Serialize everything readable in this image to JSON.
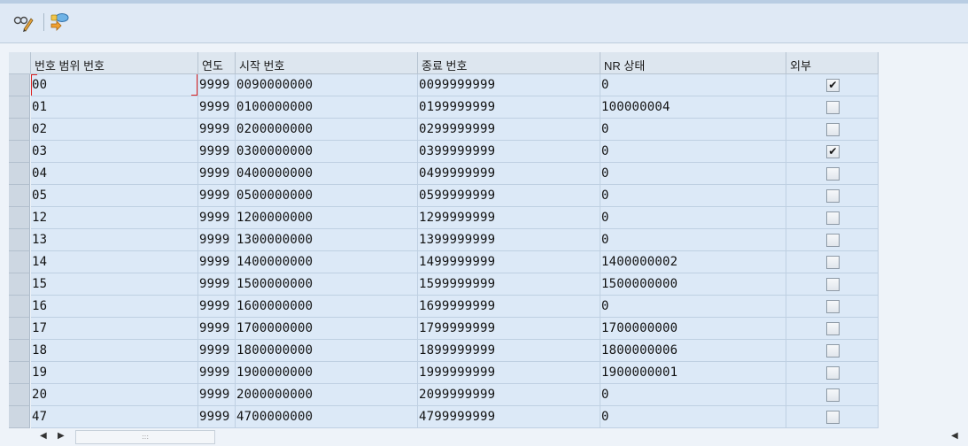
{
  "toolbar": {
    "buttons": [
      {
        "icon": "display-change-icon"
      },
      {
        "icon": "intervals-icon"
      }
    ]
  },
  "table": {
    "columns": [
      "번호 범위 번호",
      "연도",
      "시작 번호",
      "종료 번호",
      "NR 상태",
      "외부"
    ],
    "rows": [
      {
        "range": "00",
        "year": "9999",
        "from": "0090000000",
        "to": "0099999999",
        "status": "0",
        "external": true
      },
      {
        "range": "01",
        "year": "9999",
        "from": "0100000000",
        "to": "0199999999",
        "status": "100000004",
        "external": false
      },
      {
        "range": "02",
        "year": "9999",
        "from": "0200000000",
        "to": "0299999999",
        "status": "0",
        "external": false
      },
      {
        "range": "03",
        "year": "9999",
        "from": "0300000000",
        "to": "0399999999",
        "status": "0",
        "external": true
      },
      {
        "range": "04",
        "year": "9999",
        "from": "0400000000",
        "to": "0499999999",
        "status": "0",
        "external": false
      },
      {
        "range": "05",
        "year": "9999",
        "from": "0500000000",
        "to": "0599999999",
        "status": "0",
        "external": false
      },
      {
        "range": "12",
        "year": "9999",
        "from": "1200000000",
        "to": "1299999999",
        "status": "0",
        "external": false
      },
      {
        "range": "13",
        "year": "9999",
        "from": "1300000000",
        "to": "1399999999",
        "status": "0",
        "external": false
      },
      {
        "range": "14",
        "year": "9999",
        "from": "1400000000",
        "to": "1499999999",
        "status": "1400000002",
        "external": false
      },
      {
        "range": "15",
        "year": "9999",
        "from": "1500000000",
        "to": "1599999999",
        "status": "1500000000",
        "external": false
      },
      {
        "range": "16",
        "year": "9999",
        "from": "1600000000",
        "to": "1699999999",
        "status": "0",
        "external": false
      },
      {
        "range": "17",
        "year": "9999",
        "from": "1700000000",
        "to": "1799999999",
        "status": "1700000000",
        "external": false
      },
      {
        "range": "18",
        "year": "9999",
        "from": "1800000000",
        "to": "1899999999",
        "status": "1800000006",
        "external": false
      },
      {
        "range": "19",
        "year": "9999",
        "from": "1900000000",
        "to": "1999999999",
        "status": "1900000001",
        "external": false
      },
      {
        "range": "20",
        "year": "9999",
        "from": "2000000000",
        "to": "2099999999",
        "status": "0",
        "external": false
      },
      {
        "range": "47",
        "year": "9999",
        "from": "4700000000",
        "to": "4799999999",
        "status": "0",
        "external": false
      }
    ]
  },
  "scrollbar": {
    "thumb_grip": ":::"
  },
  "colors": {
    "cell_bg": "#dce9f7",
    "header_bg": "#dde6ef",
    "focus": "#dd2222"
  }
}
